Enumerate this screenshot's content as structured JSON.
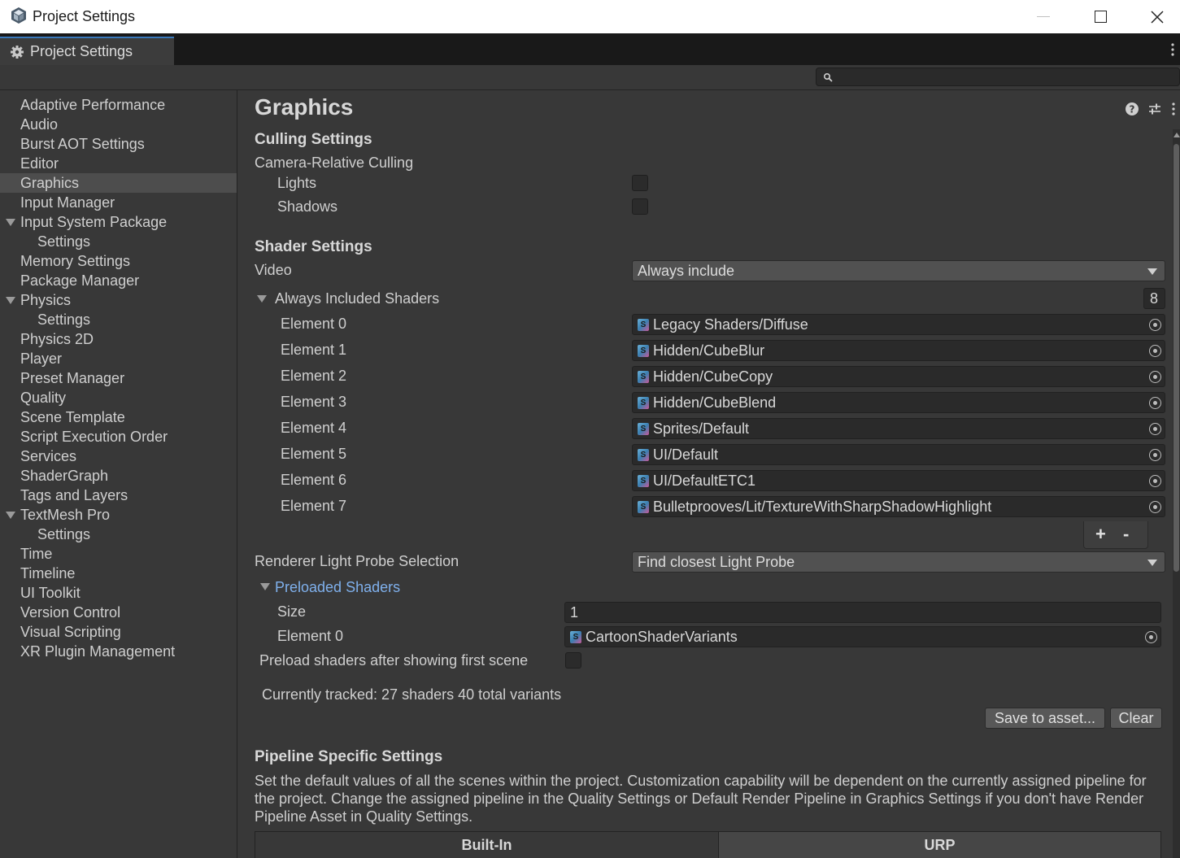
{
  "window": {
    "title": "Project Settings"
  },
  "tab": {
    "label": "Project Settings"
  },
  "search": {
    "placeholder": ""
  },
  "sidebar": {
    "items": [
      {
        "label": "Adaptive Performance"
      },
      {
        "label": "Audio"
      },
      {
        "label": "Burst AOT Settings"
      },
      {
        "label": "Editor"
      },
      {
        "label": "Graphics",
        "active": true
      },
      {
        "label": "Input Manager"
      },
      {
        "label": "Input System Package",
        "expanded": true
      },
      {
        "label": "Settings",
        "child": true
      },
      {
        "label": "Memory Settings"
      },
      {
        "label": "Package Manager"
      },
      {
        "label": "Physics",
        "expanded": true
      },
      {
        "label": "Settings",
        "child": true
      },
      {
        "label": "Physics 2D"
      },
      {
        "label": "Player"
      },
      {
        "label": "Preset Manager"
      },
      {
        "label": "Quality"
      },
      {
        "label": "Scene Template"
      },
      {
        "label": "Script Execution Order"
      },
      {
        "label": "Services"
      },
      {
        "label": "ShaderGraph"
      },
      {
        "label": "Tags and Layers"
      },
      {
        "label": "TextMesh Pro",
        "expanded": true
      },
      {
        "label": "Settings",
        "child": true
      },
      {
        "label": "Time"
      },
      {
        "label": "Timeline"
      },
      {
        "label": "UI Toolkit"
      },
      {
        "label": "Version Control"
      },
      {
        "label": "Visual Scripting"
      },
      {
        "label": "XR Plugin Management"
      }
    ]
  },
  "main": {
    "title": "Graphics",
    "culling": {
      "header": "Culling Settings",
      "camera_relative": "Camera-Relative Culling",
      "lights": "Lights",
      "lights_checked": false,
      "shadows": "Shadows",
      "shadows_checked": false
    },
    "shader": {
      "header": "Shader Settings",
      "video_label": "Video",
      "video_value": "Always include",
      "always_included_label": "Always Included Shaders",
      "always_included_count": "8",
      "elements": [
        {
          "label": "Element 0",
          "value": "Legacy Shaders/Diffuse"
        },
        {
          "label": "Element 1",
          "value": "Hidden/CubeBlur"
        },
        {
          "label": "Element 2",
          "value": "Hidden/CubeCopy"
        },
        {
          "label": "Element 3",
          "value": "Hidden/CubeBlend"
        },
        {
          "label": "Element 4",
          "value": "Sprites/Default"
        },
        {
          "label": "Element 5",
          "value": "UI/Default"
        },
        {
          "label": "Element 6",
          "value": "UI/DefaultETC1"
        },
        {
          "label": "Element 7",
          "value": "Bulletprooves/Lit/TextureWithSharpShadowHighlight"
        }
      ],
      "add_symbol": "+",
      "remove_symbol": "-",
      "light_probe_label": "Renderer Light Probe Selection",
      "light_probe_value": "Find closest Light Probe",
      "preloaded_label": "Preloaded Shaders",
      "size_label": "Size",
      "size_value": "1",
      "preloaded_element_label": "Element 0",
      "preloaded_element_value": "CartoonShaderVariants",
      "preload_after_label": "Preload shaders after showing first scene",
      "preload_after_checked": false,
      "tracked_text": "Currently tracked: 27 shaders 40 total variants",
      "save_button": "Save to asset...",
      "clear_button": "Clear"
    },
    "pipeline": {
      "header": "Pipeline Specific Settings",
      "description": "Set the default values of all the scenes within the project. Customization capability will be dependent on the currently assigned pipeline for the project. Change the assigned pipeline in the Quality Settings or Default Render Pipeline in Graphics Settings if you don't have Render Pipeline Asset in Quality Settings.",
      "tabs": [
        "Built-In",
        "URP"
      ],
      "active_tab": "Built-In"
    }
  },
  "colors": {
    "accent": "#3a79bb",
    "link": "#7fb0ec",
    "panel": "#383838",
    "field": "#2a2a2a"
  }
}
